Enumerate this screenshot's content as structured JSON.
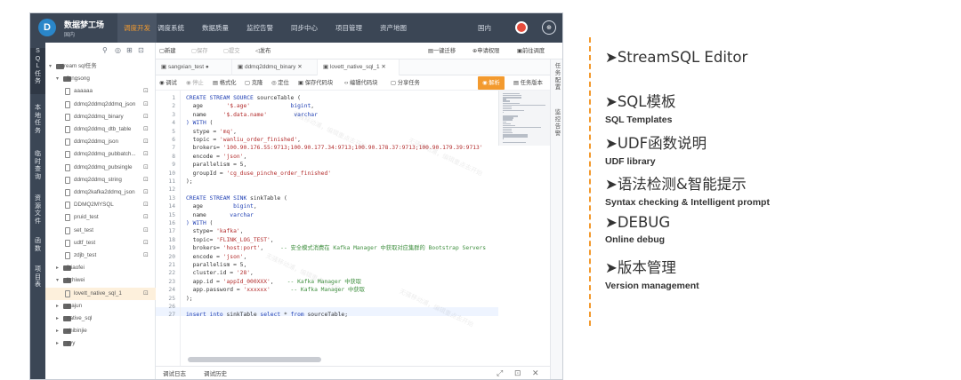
{
  "app": {
    "name": "数据梦工场",
    "sub": "国内",
    "logo": "D",
    "region": "国内",
    "user_icon": "user-icon"
  },
  "nav": [
    "调度开发",
    "调度系统",
    "数据质量",
    "监控告警",
    "同步中心",
    "项目管理",
    "资产地图"
  ],
  "vtabs": [
    "SQL任务",
    "本地任务",
    "临时查询",
    "资源文件",
    "函数",
    "项目表"
  ],
  "tree": {
    "rows": [
      {
        "label": "stream sql任务"
      },
      {
        "label": "fengsong"
      },
      {
        "label": "aaaaaa"
      },
      {
        "label": "ddmq2ddmq2ddmq_json"
      },
      {
        "label": "ddmq2ddmq_binary"
      },
      {
        "label": "ddmq2ddmq_dtb_table"
      },
      {
        "label": "ddmq2ddmq_json"
      },
      {
        "label": "ddmq2ddmq_pubbatch..."
      },
      {
        "label": "ddmq2ddmq_pubsingle"
      },
      {
        "label": "ddmq2ddmq_string"
      },
      {
        "label": "ddmq2kafka2ddmq_json"
      },
      {
        "label": "DDMQ2MYSQL"
      },
      {
        "label": "pruid_test"
      },
      {
        "label": "set_test"
      },
      {
        "label": "udtf_test"
      },
      {
        "label": "zdjb_test"
      },
      {
        "label": "fxiaofei"
      },
      {
        "label": "lizhiwei"
      },
      {
        "label": "lovett_native_sql_1"
      },
      {
        "label": "majun"
      },
      {
        "label": "native_sql"
      },
      {
        "label": "shibinjie"
      },
      {
        "label": "yyy"
      }
    ]
  },
  "toolbar": [
    "新建",
    "保存",
    "提交",
    "发布",
    "一键迁移",
    "申请权限",
    "前往调度"
  ],
  "file_tabs": [
    "sangxian_test",
    "ddmq2ddmq_binary",
    "lovett_native_sql_1"
  ],
  "editor_tools": [
    "调试",
    "停止",
    "格式化",
    "克隆",
    "定位",
    "保存代码块",
    "编辑代码块",
    "分享任务",
    "解析",
    "任务版本"
  ],
  "code": [
    [
      [
        "k",
        "CREATE STREAM SOURCE "
      ],
      [
        "n",
        "sourceTable ("
      ]
    ],
    [
      [
        "n",
        "  age       "
      ],
      [
        "s",
        "'$.age'"
      ],
      [
        "n",
        "            "
      ],
      [
        "k",
        "bigint"
      ],
      [
        "n",
        ","
      ]
    ],
    [
      [
        "n",
        "  name     "
      ],
      [
        "s",
        "'$.data.name'"
      ],
      [
        "n",
        "        "
      ],
      [
        "k",
        "varchar"
      ]
    ],
    [
      [
        "k",
        ") WITH"
      ],
      [
        "n",
        " ("
      ]
    ],
    [
      [
        "n",
        "  stype = "
      ],
      [
        "s",
        "'mq'"
      ],
      [
        "n",
        ","
      ]
    ],
    [
      [
        "n",
        "  topic = "
      ],
      [
        "s",
        "'wanliu_order_finished'"
      ],
      [
        "n",
        ","
      ]
    ],
    [
      [
        "n",
        "  brokers= "
      ],
      [
        "s",
        "'100.90.176.55:9713;100.90.177.34:9713;100.90.178.37:9713;100.90.179.39:9713'"
      ]
    ],
    [
      [
        "n",
        "  encode = "
      ],
      [
        "s",
        "'json'"
      ],
      [
        "n",
        ","
      ]
    ],
    [
      [
        "n",
        "  parallelism = 5,"
      ]
    ],
    [
      [
        "n",
        "  groupId = "
      ],
      [
        "s",
        "'cg_duse_pinche_order_finished'"
      ]
    ],
    [
      [
        "n",
        ");"
      ]
    ],
    [
      [
        "n",
        ""
      ]
    ],
    [
      [
        "k",
        "CREATE STREAM SINK "
      ],
      [
        "n",
        "sinkTable ("
      ]
    ],
    [
      [
        "n",
        "  age         "
      ],
      [
        "k",
        "bigint"
      ],
      [
        "n",
        ","
      ]
    ],
    [
      [
        "n",
        "  name       "
      ],
      [
        "k",
        "varchar"
      ]
    ],
    [
      [
        "k",
        ") WITH"
      ],
      [
        "n",
        " ("
      ]
    ],
    [
      [
        "n",
        "  stype= "
      ],
      [
        "s",
        "'kafka'"
      ],
      [
        "n",
        ","
      ]
    ],
    [
      [
        "n",
        "  topic= "
      ],
      [
        "s",
        "'FLINK_LOG_TEST'"
      ],
      [
        "n",
        ","
      ]
    ],
    [
      [
        "n",
        "  brokers= "
      ],
      [
        "s",
        "'host:port'"
      ],
      [
        "n",
        ",     "
      ],
      [
        "c",
        "-- 安全模式消费在 Kafka Manager 中获取对应集群的 Bootstrap Servers"
      ]
    ],
    [
      [
        "n",
        "  encode = "
      ],
      [
        "s",
        "'json'"
      ],
      [
        "n",
        ","
      ]
    ],
    [
      [
        "n",
        "  parallelism = 5,"
      ]
    ],
    [
      [
        "n",
        "  cluster.id = "
      ],
      [
        "s",
        "'28'"
      ],
      [
        "n",
        ","
      ]
    ],
    [
      [
        "n",
        "  app.id = "
      ],
      [
        "s",
        "'appId_000XXX'"
      ],
      [
        "n",
        ",    "
      ],
      [
        "c",
        "-- Kafka Manager 中获取"
      ]
    ],
    [
      [
        "n",
        "  app.password = "
      ],
      [
        "s",
        "'xxxxxx'"
      ],
      [
        "n",
        "      "
      ],
      [
        "c",
        "-- Kafka Manager 中获取"
      ]
    ],
    [
      [
        "n",
        ");"
      ]
    ],
    [
      [
        "n",
        ""
      ]
    ],
    [
      [
        "k",
        "insert into "
      ],
      [
        "n",
        "sinkTable "
      ],
      [
        "k",
        "select"
      ],
      [
        "n",
        " * "
      ],
      [
        "k",
        "from"
      ],
      [
        "n",
        " sourceTable;"
      ]
    ]
  ],
  "line_numbers": [
    "1",
    "2",
    "3",
    "4",
    "5",
    "6",
    "7",
    "8",
    "9",
    "10",
    "11",
    "12",
    "13",
    "14",
    "15",
    "16",
    "17",
    "18",
    "19",
    "20",
    "21",
    "22",
    "23",
    "24",
    "25",
    "26",
    "27"
  ],
  "bottom": [
    "调试日志",
    "调试历史"
  ],
  "right_tabs": [
    "任务配置",
    "监控告警"
  ],
  "watermark": "无骚移动浦，编辑重点去开始",
  "features": [
    {
      "title": "➤StreamSQL Editor",
      "desc": ""
    },
    {
      "title": "➤SQL模板",
      "desc": "SQL Templates"
    },
    {
      "title": "➤UDF函数说明",
      "desc": "UDF library"
    },
    {
      "title": "➤语法检测&智能提示",
      "desc": "Syntax checking & Intelligent prompt"
    },
    {
      "title": "➤DEBUG",
      "desc": "Online debug"
    },
    {
      "title": "➤版本管理",
      "desc": "Version management"
    }
  ],
  "colors": {
    "accent": "#f39a2e",
    "sidebar": "#3b4655",
    "keyword": "#1f3fb3",
    "string": "#b32d2d",
    "comment": "#3f8f3f"
  }
}
